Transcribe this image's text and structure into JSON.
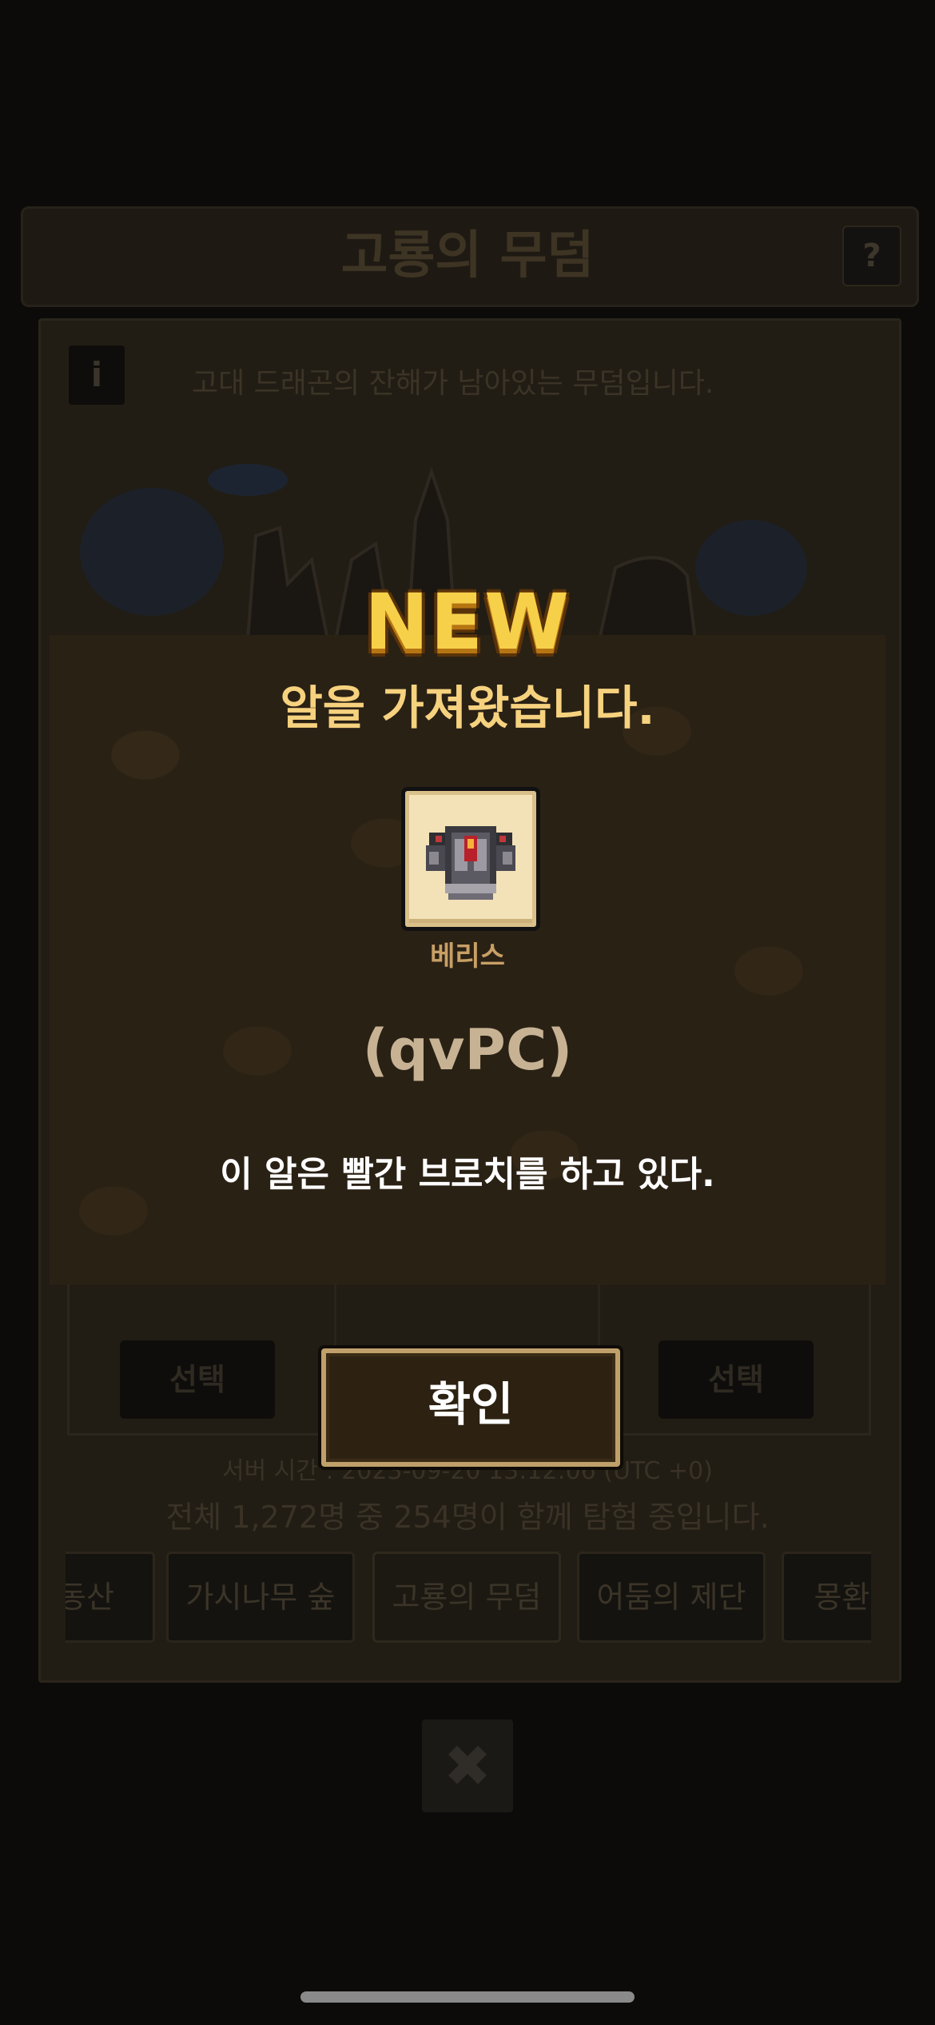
{
  "background": {
    "title": "고룡의 무덤",
    "help_icon": "?",
    "info_icon": "i",
    "description": "고대 드래곤의 잔해가 남아있는 무덤입니다.",
    "select_label": "선택",
    "server_time": "서버 시간 : 2023-09-20 13:12:06 (UTC +0)",
    "players": "전체 1,272명 중 254명이 함께 탐험 중입니다.",
    "tabs": [
      "동산",
      "가시나무 숲",
      "고룡의 무덤",
      "어둠의 제단",
      "몽환의"
    ],
    "active_tab": "고룡의 무덤",
    "close_icon": "✖"
  },
  "popup": {
    "badge": "NEW",
    "title": "알을 가져왔습니다.",
    "item": {
      "name": "베리스",
      "code": "(qvPC)",
      "icon": "egg-with-brooch-icon"
    },
    "description": "이 알은 빨간 브로치를 하고 있다.",
    "confirm_label": "확인"
  },
  "colors": {
    "badge": "#f7d04a",
    "title": "#f6d27f",
    "item_name": "#c89f65",
    "item_code": "#c7b394",
    "band": "#2a2115"
  }
}
